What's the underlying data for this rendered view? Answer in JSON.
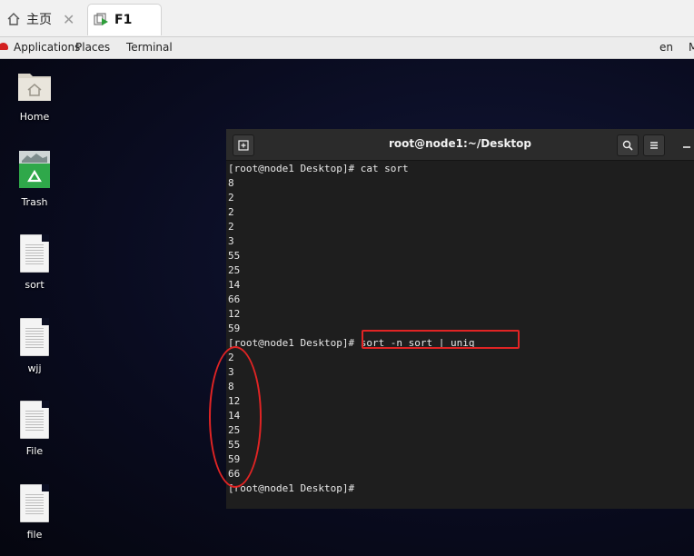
{
  "tabs": [
    {
      "label": "主页",
      "icon": "home-icon",
      "close": "✕"
    },
    {
      "label": "F1",
      "icon": "vm-icon"
    }
  ],
  "panel": {
    "applications": "Applications",
    "places": "Places",
    "terminal": "Terminal",
    "lang": "en",
    "right_clip": "M"
  },
  "desktop_icons": [
    {
      "label": "Home",
      "icon": "home-folder-icon"
    },
    {
      "label": "Trash",
      "icon": "trash-icon"
    },
    {
      "label": "sort",
      "icon": "text-file-icon"
    },
    {
      "label": "wjj",
      "icon": "text-file-icon"
    },
    {
      "label": "File",
      "icon": "text-file-icon"
    },
    {
      "label": "file",
      "icon": "text-file-icon"
    }
  ],
  "terminal": {
    "title": "root@node1:~/Desktop",
    "lines": [
      "[root@node1 Desktop]# cat sort",
      "8",
      "2",
      "2",
      "2",
      "3",
      "55",
      "25",
      "14",
      "66",
      "12",
      "59",
      "[root@node1 Desktop]# sort -n sort | uniq",
      "2",
      "3",
      "8",
      "12",
      "14",
      "25",
      "55",
      "59",
      "66",
      "[root@node1 Desktop]#"
    ]
  },
  "colors": {
    "annotation": "#e02424",
    "terminal_bg": "#1e1e1e"
  }
}
